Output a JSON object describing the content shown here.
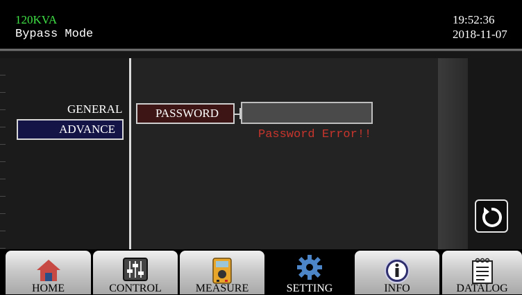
{
  "header": {
    "model": "120KVA",
    "mode": "Bypass Mode",
    "time": "19:52:36",
    "date": "2018-11-07"
  },
  "sidebar": {
    "items": [
      {
        "label": "GENERAL",
        "selected": false
      },
      {
        "label": "ADVANCE",
        "selected": true
      }
    ]
  },
  "password": {
    "label": "PASSWORD",
    "value": "",
    "error": "Password Error!!"
  },
  "nav": {
    "tabs": [
      {
        "label": "HOME",
        "icon": "house-icon"
      },
      {
        "label": "CONTROL",
        "icon": "sliders-icon"
      },
      {
        "label": "MEASURE",
        "icon": "multimeter-icon"
      },
      {
        "label": "SETTING",
        "icon": "gear-icon",
        "active": true
      },
      {
        "label": "INFO",
        "icon": "info-icon"
      },
      {
        "label": "DATALOG",
        "icon": "notepad-icon"
      }
    ]
  },
  "colors": {
    "model_text": "#3fe045",
    "error_text": "#c8352d",
    "advance_bg": "#141446",
    "password_label_bg": "#3d1515"
  }
}
